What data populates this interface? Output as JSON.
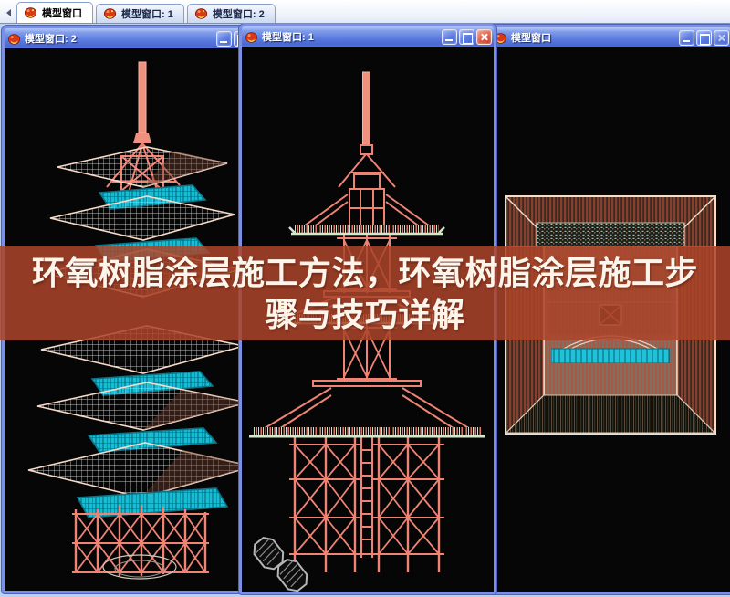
{
  "colors": {
    "titlebar_blue": "#5a7ade",
    "window_border": "#7b90e2",
    "viewport_background": "#060606",
    "wireframe_salmon": "#ef8374",
    "wireframe_cyan": "#1fc2d8",
    "wireframe_pale": "#f7d9c8",
    "eave_pale_green": "#d2e8cc",
    "close_button_red": "#e06450",
    "banner_background": "rgba(171,69,42,0.86)",
    "banner_text": "#fbf5ec"
  },
  "tab_bar": {
    "tabs": [
      {
        "label": "模型窗口",
        "active": true
      },
      {
        "label": "模型窗口: 1",
        "active": false
      },
      {
        "label": "模型窗口: 2",
        "active": false
      }
    ]
  },
  "windows": [
    {
      "title": "模型窗口: 2",
      "view": "perspective",
      "buttons": [
        "minimize",
        "maximize"
      ]
    },
    {
      "title": "模型窗口: 1",
      "view": "front-elevation",
      "buttons": [
        "minimize",
        "maximize",
        "close"
      ]
    },
    {
      "title": "模型窗口",
      "view": "top-plan",
      "buttons": [
        "minimize",
        "maximize",
        "close-disabled"
      ]
    }
  ],
  "overlay": {
    "line1": "环氧树脂涂层施工方法，环氧树脂涂层施工步",
    "line2": "骤与技巧详解"
  },
  "icons": {
    "tab_scroll_left": "left-arrow-icon",
    "window_icon": "model-window-icon",
    "minimize": "minimize-icon",
    "maximize": "maximize-icon",
    "close": "close-icon",
    "footprints": "footprints-icon"
  }
}
